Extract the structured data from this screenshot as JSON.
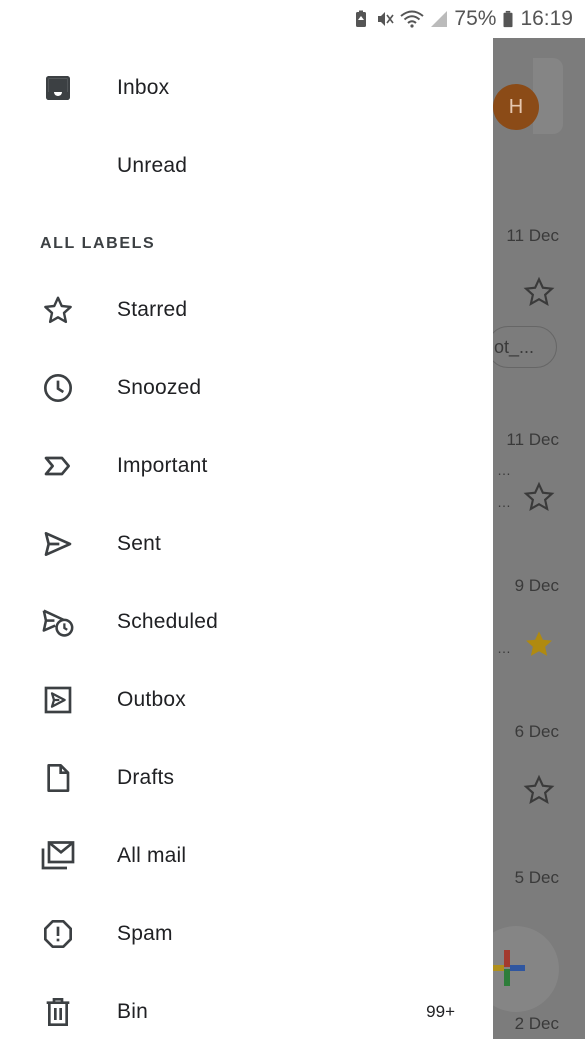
{
  "status_bar": {
    "battery_percent": "75%",
    "time": "16:19",
    "icons": [
      "battery-saver-icon",
      "mute-icon",
      "wifi-icon",
      "signal-icon",
      "battery-icon"
    ]
  },
  "drawer": {
    "top_items": [
      {
        "label": "Inbox",
        "icon": "inbox-icon"
      },
      {
        "label": "Unread",
        "icon": ""
      }
    ],
    "section_header": "ALL LABELS",
    "label_items": [
      {
        "label": "Starred",
        "icon": "star-icon"
      },
      {
        "label": "Snoozed",
        "icon": "clock-icon"
      },
      {
        "label": "Important",
        "icon": "important-icon"
      },
      {
        "label": "Sent",
        "icon": "send-icon"
      },
      {
        "label": "Scheduled",
        "icon": "scheduled-send-icon"
      },
      {
        "label": "Outbox",
        "icon": "outbox-icon"
      },
      {
        "label": "Drafts",
        "icon": "draft-icon"
      },
      {
        "label": "All mail",
        "icon": "all-mail-icon"
      },
      {
        "label": "Spam",
        "icon": "spam-icon"
      },
      {
        "label": "Bin",
        "icon": "bin-icon",
        "count": "99+"
      }
    ]
  },
  "background": {
    "avatar_initial": "H",
    "dates": [
      "11 Dec",
      "11 Dec",
      "9 Dec",
      "6 Dec",
      "5 Dec",
      "2 Dec"
    ],
    "chip_text": "ot_...",
    "starred_color": "#c79a12"
  }
}
